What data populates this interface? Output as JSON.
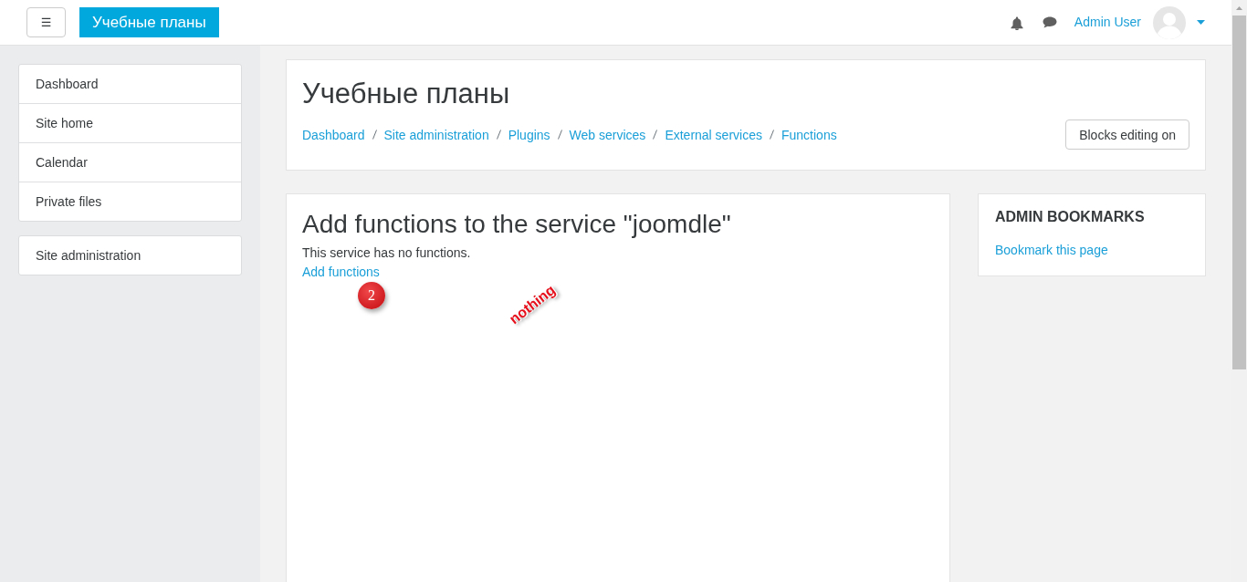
{
  "navbar": {
    "menu_button": "☰",
    "brand": "Учебные планы",
    "user_name": "Admin User"
  },
  "nav_drawer": {
    "groups": [
      {
        "items": [
          {
            "label": "Dashboard"
          },
          {
            "label": "Site home"
          },
          {
            "label": "Calendar"
          },
          {
            "label": "Private files"
          }
        ]
      },
      {
        "items": [
          {
            "label": "Site administration"
          }
        ]
      }
    ]
  },
  "page_header": {
    "title": "Учебные планы",
    "breadcrumb": [
      "Dashboard",
      "Site administration",
      "Plugins",
      "Web services",
      "External services",
      "Functions"
    ],
    "edit_button": "Blocks editing on"
  },
  "main": {
    "heading": "Add functions to the service \"joomdle\"",
    "message": "This service has no functions.",
    "link": "Add functions",
    "annotations": [
      {
        "kind": "badge",
        "text": "2"
      },
      {
        "kind": "note",
        "text": "nothing"
      }
    ]
  },
  "blocks": [
    {
      "title": "ADMIN BOOKMARKS",
      "link": "Bookmark this page"
    }
  ]
}
